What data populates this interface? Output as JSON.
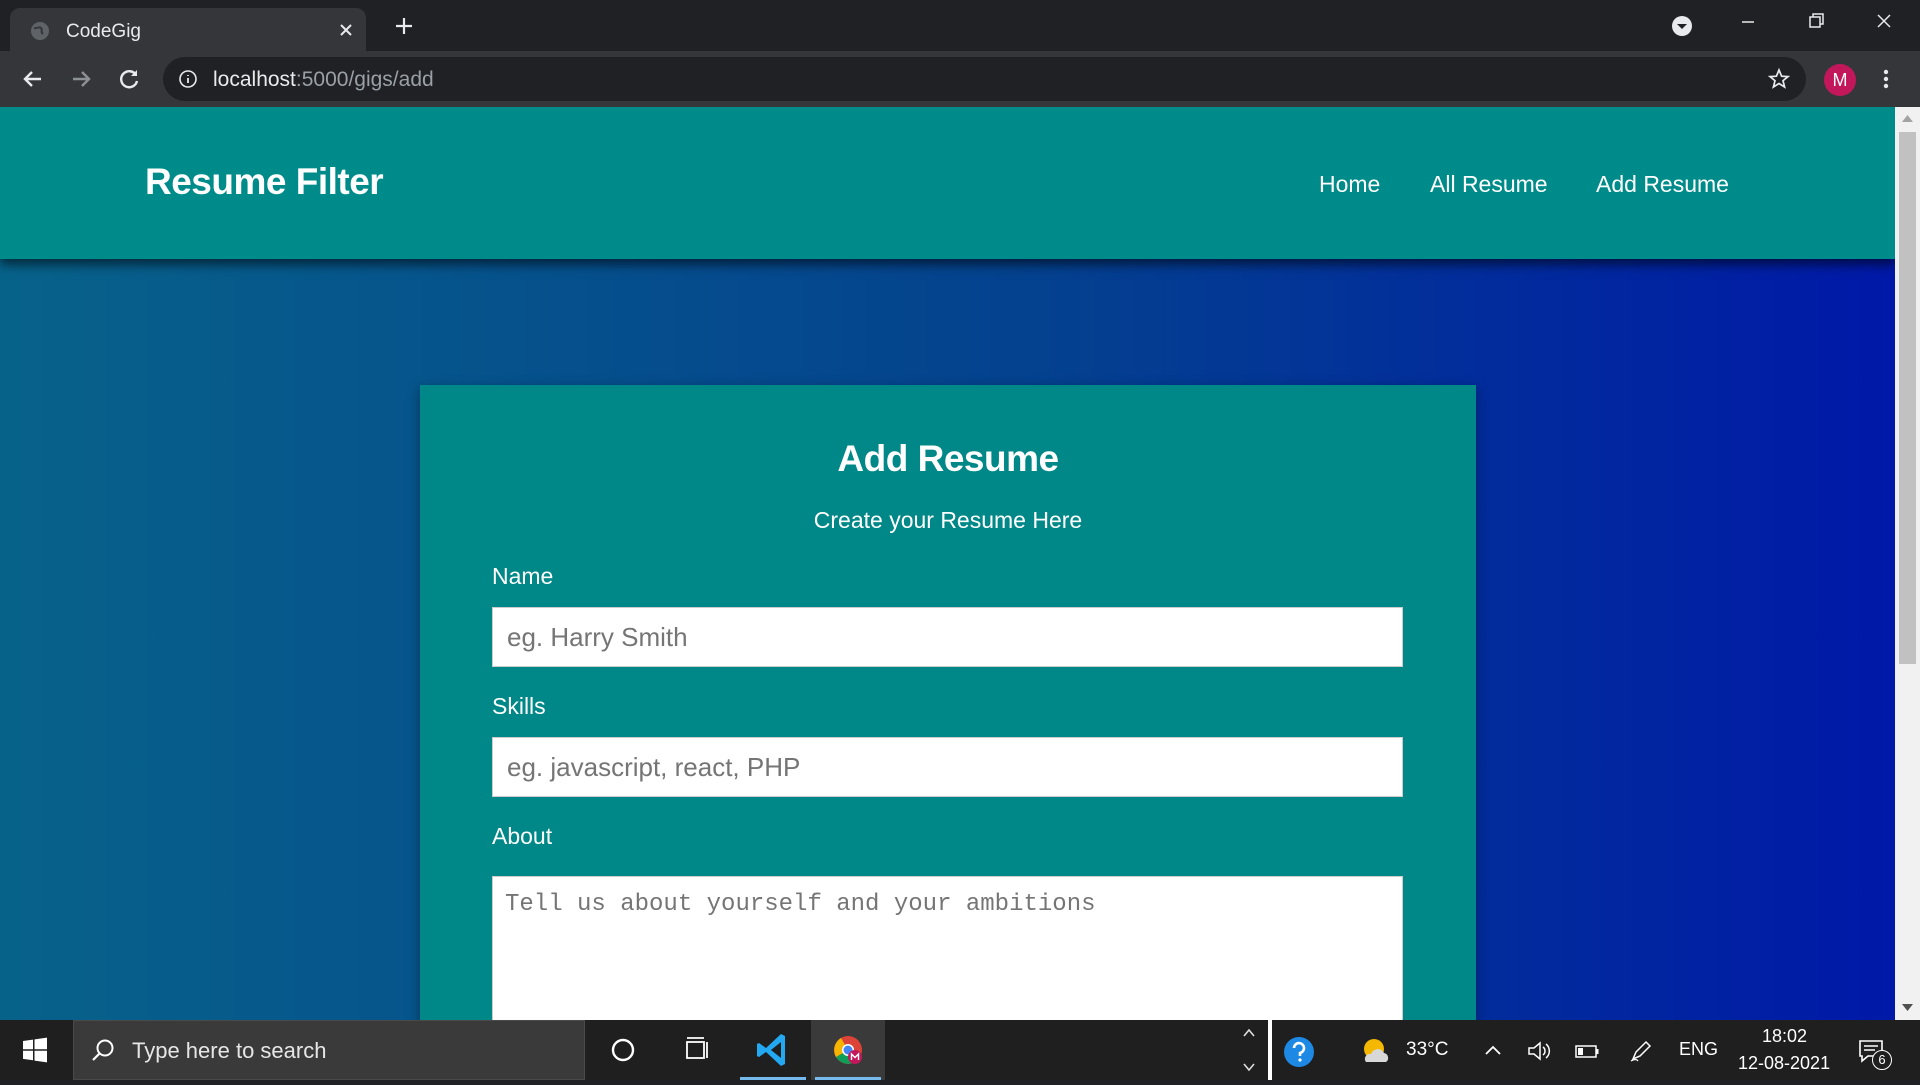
{
  "browser": {
    "tab": {
      "title": "CodeGig"
    },
    "url": {
      "host": "localhost",
      "path": ":5000/gigs/add"
    },
    "profile_initial": "M"
  },
  "site": {
    "brand": "Resume Filter",
    "nav": [
      "Home",
      "All Resume",
      "Add Resume"
    ]
  },
  "form": {
    "title": "Add Resume",
    "subtitle": "Create your Resume Here",
    "name_label": "Name",
    "name_placeholder": "eg. Harry Smith",
    "skills_label": "Skills",
    "skills_placeholder": "eg. javascript, react, PHP",
    "about_label": "About",
    "about_placeholder": "Tell us about yourself and your ambitions"
  },
  "taskbar": {
    "search_placeholder": "Type here to search",
    "weather": "33°C",
    "language": "ENG",
    "time": "18:02",
    "date": "12-08-2021",
    "notification_count": "6"
  },
  "colors": {
    "navbar": "#008b8b",
    "card": "#008787",
    "page_gradient_start": "#07628a",
    "page_gradient_end": "#0019a8"
  }
}
